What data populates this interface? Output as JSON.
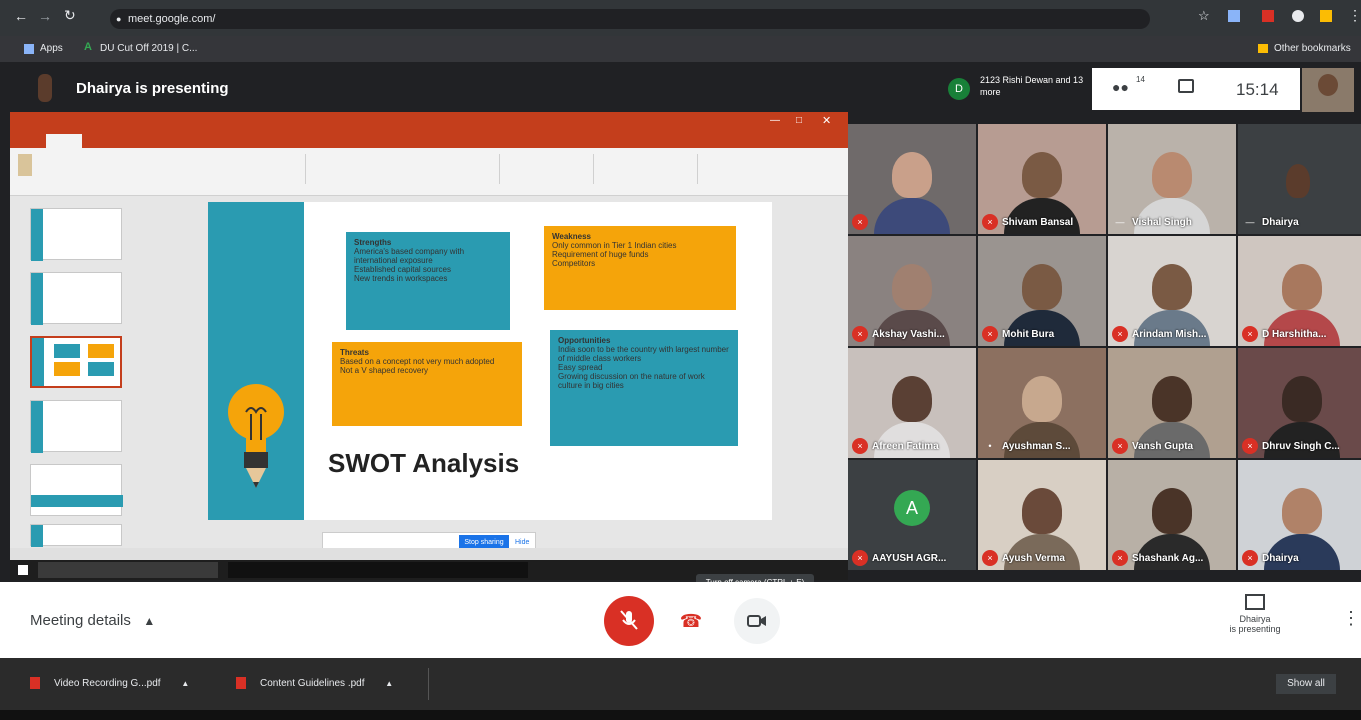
{
  "browser": {
    "url": "meet.google.com/",
    "bookmarks": [
      "Apps",
      "DU Cut Off 2019 | C..."
    ],
    "other_bookmarks": "Other bookmarks"
  },
  "meet_header": {
    "presenter_banner": "Dhairya is presenting",
    "participants_label": "2123 Rishi Dewan and 13 more",
    "participants_avatar_letter": "D",
    "participants_count": "14",
    "time": "15:14"
  },
  "slide": {
    "title": "SWOT Analysis",
    "strengths": {
      "heading": "Strengths",
      "lines": [
        "America's based company with international exposure",
        "Established capital sources",
        "New trends in workspaces"
      ]
    },
    "weaknesses": {
      "heading": "Weakness",
      "lines": [
        "Only common in Tier 1 Indian cities",
        "Requirement of huge funds",
        "Competitors"
      ]
    },
    "threats": {
      "heading": "Threats",
      "lines": [
        "Based on a concept not very much adopted",
        "Not a V shaped recovery"
      ]
    },
    "opportunities": {
      "heading": "Opportunities",
      "lines": [
        "India soon to be the country with largest number of middle class workers",
        "Easy spread",
        "Growing discussion on the nature of work culture in big cities"
      ]
    }
  },
  "screenshare_popup": {
    "stop_label": "Stop sharing",
    "hide_label": "Hide"
  },
  "participants": [
    {
      "name": ""
    },
    {
      "name": "Shivam Bansal"
    },
    {
      "name": "Vishal Singh"
    },
    {
      "name": "Dhairya"
    },
    {
      "name": "Akshay Vashi..."
    },
    {
      "name": "Mohit Bura"
    },
    {
      "name": "Arindam Mish..."
    },
    {
      "name": "D Harshitha..."
    },
    {
      "name": "Afreen Fatima"
    },
    {
      "name": "Ayushman S..."
    },
    {
      "name": "Vansh Gupta"
    },
    {
      "name": "Dhruv Singh C..."
    },
    {
      "name": "AAYUSH AGR...",
      "avatar_letter": "A"
    },
    {
      "name": "Ayush Verma"
    },
    {
      "name": "Shashank Ag..."
    },
    {
      "name": "Dhairya"
    }
  ],
  "bottom_bar": {
    "meeting_details": "Meeting details",
    "camera_tooltip": "Turn off camera (CTRL + E)",
    "presenting_line1": "Dhairya",
    "presenting_line2": "is presenting"
  },
  "downloads": {
    "items": [
      "Video Recording G...pdf",
      "Content Guidelines .pdf"
    ],
    "show_all": "Show all"
  },
  "colors": {
    "teal": "#2a9bb1",
    "orange": "#f5a40a",
    "ppt_red": "#c43e1c",
    "end_call_red": "#d93025"
  }
}
